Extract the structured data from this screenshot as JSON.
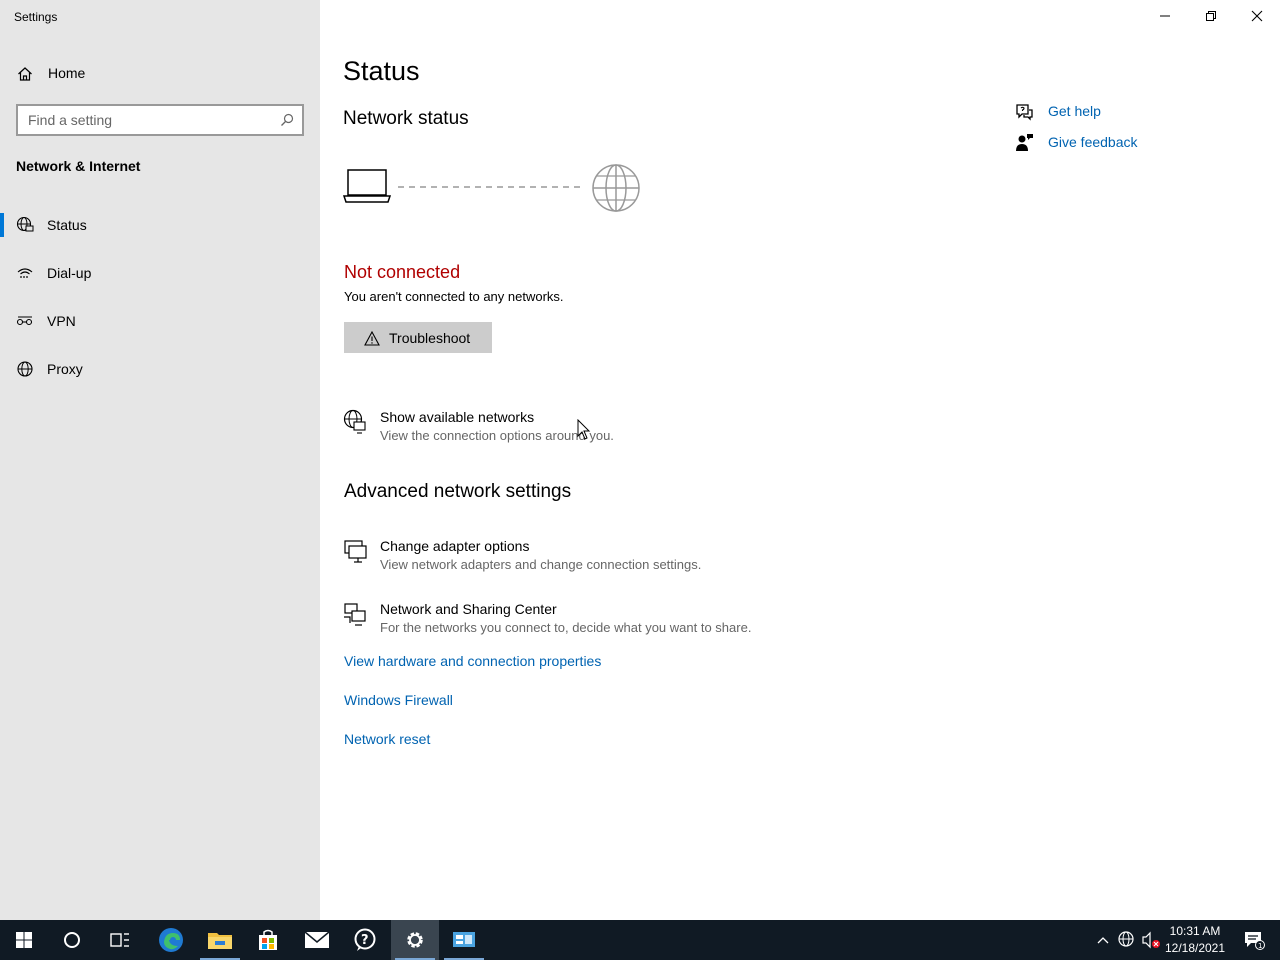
{
  "window": {
    "title": "Settings",
    "controls": {
      "minimize": "minimize-icon",
      "restore": "restore-icon",
      "close": "close-icon"
    }
  },
  "sidebar": {
    "home_label": "Home",
    "search_placeholder": "Find a setting",
    "section_title": "Network & Internet",
    "items": [
      {
        "label": "Status",
        "icon": "globe-monitor-icon",
        "active": true
      },
      {
        "label": "Dial-up",
        "icon": "dialup-icon",
        "active": false
      },
      {
        "label": "VPN",
        "icon": "vpn-icon",
        "active": false
      },
      {
        "label": "Proxy",
        "icon": "globe-icon",
        "active": false
      }
    ]
  },
  "main": {
    "title": "Status",
    "network_status_heading": "Network status",
    "connection": {
      "status": "Not connected",
      "description": "You aren't connected to any networks.",
      "status_color": "#b00000"
    },
    "troubleshoot_label": "Troubleshoot",
    "show_networks": {
      "title": "Show available networks",
      "description": "View the connection options around you."
    },
    "advanced_heading": "Advanced network settings",
    "advanced_options": [
      {
        "title": "Change adapter options",
        "description": "View network adapters and change connection settings."
      },
      {
        "title": "Network and Sharing Center",
        "description": "For the networks you connect to, decide what you want to share."
      }
    ],
    "links": [
      "View hardware and connection properties",
      "Windows Firewall",
      "Network reset"
    ],
    "help": {
      "get_help": "Get help",
      "give_feedback": "Give feedback"
    },
    "accent_color": "#0063b1"
  },
  "taskbar": {
    "apps": [
      "start-icon",
      "search-circle-icon",
      "task-view-icon",
      "edge-icon",
      "file-explorer-icon",
      "store-icon",
      "mail-icon",
      "get-help-icon",
      "settings-icon",
      "control-panel-icon"
    ],
    "active_app": "settings-icon",
    "clock": {
      "time": "10:31 AM",
      "date": "12/18/2021"
    },
    "notification_count": "1"
  }
}
